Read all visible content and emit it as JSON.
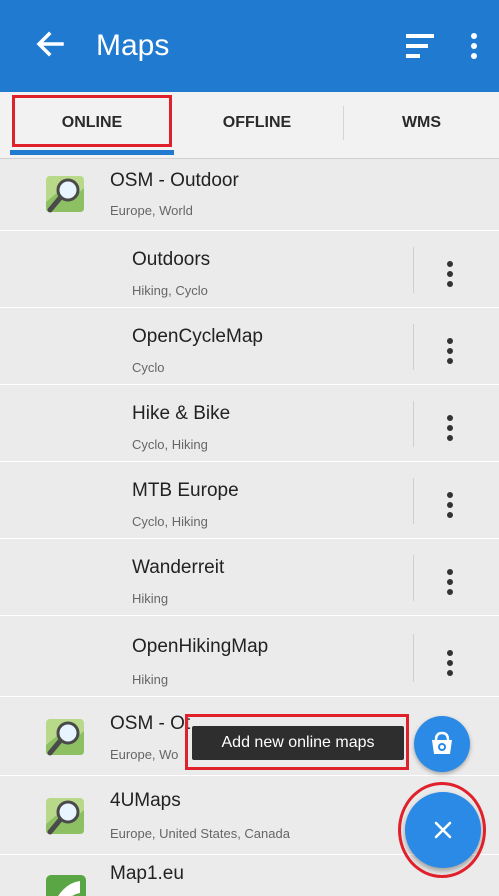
{
  "toolbar": {
    "title": "Maps"
  },
  "tabs": [
    {
      "label": "ONLINE",
      "selected": true
    },
    {
      "label": "OFFLINE",
      "selected": false
    },
    {
      "label": "WMS",
      "selected": false
    }
  ],
  "groups": [
    {
      "name": "OSM - Outdoor",
      "sub": "Europe, World",
      "items": [
        {
          "name": "Outdoors",
          "sub": "Hiking, Cyclo"
        },
        {
          "name": "OpenCycleMap",
          "sub": "Cyclo"
        },
        {
          "name": "Hike & Bike",
          "sub": "Cyclo, Hiking"
        },
        {
          "name": "MTB Europe",
          "sub": "Cyclo, Hiking"
        },
        {
          "name": "Wanderreit",
          "sub": "Hiking"
        },
        {
          "name": "OpenHikingMap",
          "sub": "Hiking"
        }
      ]
    },
    {
      "name": "OSM - Ot",
      "sub": "Europe, Wo"
    },
    {
      "name": "4UMaps",
      "sub": "Europe, United States, Canada"
    },
    {
      "name": "Map1.eu",
      "sub": ""
    }
  ],
  "tooltip": {
    "text": "Add new online maps"
  },
  "colors": {
    "primary": "#1f7ad0",
    "fab": "#2a8ae6",
    "highlight": "#e0202a"
  }
}
